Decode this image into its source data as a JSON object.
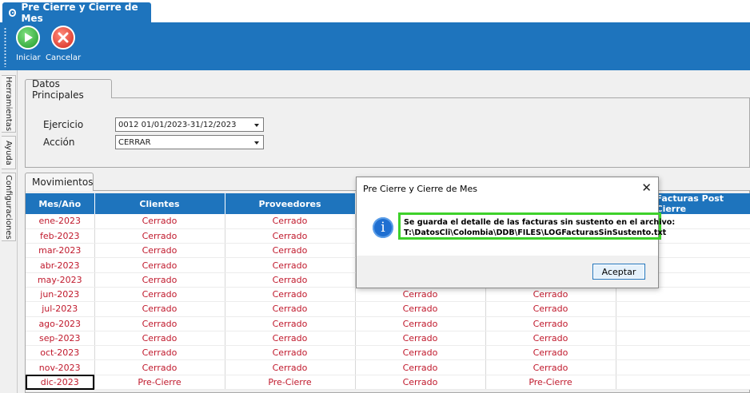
{
  "window": {
    "tab_title": "Pre Cierre y Cierre de Mes"
  },
  "toolbar": {
    "start_label": "Iniciar",
    "cancel_label": "Cancelar"
  },
  "sidetabs": [
    "Herramientas",
    "Ayuda",
    "Configuraciones"
  ],
  "datos": {
    "tab_label": "Datos Principales",
    "ejercicio_label": "Ejercicio",
    "ejercicio_value": "0012 01/01/2023-31/12/2023",
    "accion_label": "Acción",
    "accion_value": "CERRAR"
  },
  "movimientos": {
    "tab_label": "Movimientos",
    "columns": [
      "Mes/Año",
      "Clientes",
      "Proveedores",
      "",
      "",
      "Facturas Post Cierre"
    ],
    "rows": [
      [
        "ene-2023",
        "Cerrado",
        "Cerrado",
        "",
        "",
        ""
      ],
      [
        "feb-2023",
        "Cerrado",
        "Cerrado",
        "",
        "",
        ""
      ],
      [
        "mar-2023",
        "Cerrado",
        "Cerrado",
        "",
        "",
        ""
      ],
      [
        "abr-2023",
        "Cerrado",
        "Cerrado",
        "",
        "",
        ""
      ],
      [
        "may-2023",
        "Cerrado",
        "Cerrado",
        "",
        "",
        ""
      ],
      [
        "jun-2023",
        "Cerrado",
        "Cerrado",
        "Cerrado",
        "Cerrado",
        ""
      ],
      [
        "jul-2023",
        "Cerrado",
        "Cerrado",
        "Cerrado",
        "Cerrado",
        ""
      ],
      [
        "ago-2023",
        "Cerrado",
        "Cerrado",
        "Cerrado",
        "Cerrado",
        ""
      ],
      [
        "sep-2023",
        "Cerrado",
        "Cerrado",
        "Cerrado",
        "Cerrado",
        ""
      ],
      [
        "oct-2023",
        "Cerrado",
        "Cerrado",
        "Cerrado",
        "Cerrado",
        ""
      ],
      [
        "nov-2023",
        "Cerrado",
        "Cerrado",
        "Cerrado",
        "Cerrado",
        ""
      ],
      [
        "dic-2023",
        "Pre-Cierre",
        "Pre-Cierre",
        "Cerrado",
        "Pre-Cierre",
        ""
      ]
    ]
  },
  "dialog": {
    "title": "Pre Cierre y Cierre de Mes",
    "close_glyph": "✕",
    "icon_glyph": "i",
    "message_line1": "Se guarda el detalle de las facturas sin sustento en el archivo:",
    "message_line2": "T:\\DatosCli\\Colombia\\DDB\\FILES\\LOGFacturasSinSustento.txt",
    "ok_label": "Aceptar"
  },
  "colors": {
    "accent": "#1e74bd",
    "status_text": "#c0192c",
    "highlight": "#3ed12a"
  }
}
